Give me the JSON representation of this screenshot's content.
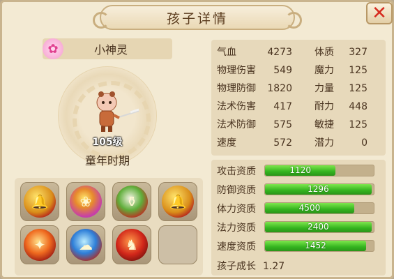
{
  "title": "孩子详情",
  "close_icon": "close-icon",
  "child": {
    "name": "小神灵",
    "name_icon": "lotus-icon",
    "level": "105级",
    "stage": "童年时期"
  },
  "skills": [
    {
      "icon": "golden-bell-skill-icon",
      "style": "gold"
    },
    {
      "icon": "lotus-skill-icon",
      "style": "pink"
    },
    {
      "icon": "vase-skill-icon",
      "style": "vase"
    },
    {
      "icon": "golden-bell-skill-icon",
      "style": "gold"
    },
    {
      "icon": "fire-spirit-skill-icon",
      "style": "fire"
    },
    {
      "icon": "cloud-wave-skill-icon",
      "style": "wave"
    },
    {
      "icon": "red-figure-skill-icon",
      "style": "red"
    },
    {
      "icon": "empty-skill-slot",
      "style": "empty"
    }
  ],
  "stats_left": [
    {
      "label": "气血",
      "value": "4273"
    },
    {
      "label": "物理伤害",
      "value": "549"
    },
    {
      "label": "物理防御",
      "value": "1820"
    },
    {
      "label": "法术伤害",
      "value": "417"
    },
    {
      "label": "法术防御",
      "value": "575"
    },
    {
      "label": "速度",
      "value": "572"
    }
  ],
  "stats_right": [
    {
      "label": "体质",
      "value": "327"
    },
    {
      "label": "魔力",
      "value": "125"
    },
    {
      "label": "力量",
      "value": "125"
    },
    {
      "label": "耐力",
      "value": "448"
    },
    {
      "label": "敏捷",
      "value": "125"
    },
    {
      "label": "潜力",
      "value": "0"
    }
  ],
  "aptitudes": [
    {
      "label": "攻击资质",
      "value": "1120",
      "fill": 0.65
    },
    {
      "label": "防御资质",
      "value": "1296",
      "fill": 0.98
    },
    {
      "label": "体力资质",
      "value": "4500",
      "fill": 0.82
    },
    {
      "label": "法力资质",
      "value": "2400",
      "fill": 0.98
    },
    {
      "label": "速度资质",
      "value": "1452",
      "fill": 0.93
    }
  ],
  "growth": {
    "label": "孩子成长",
    "value": "1.27"
  },
  "colors": {
    "bar_fill": "#34b41f",
    "close": "#d62b1f",
    "panel": "#f3ead3"
  }
}
